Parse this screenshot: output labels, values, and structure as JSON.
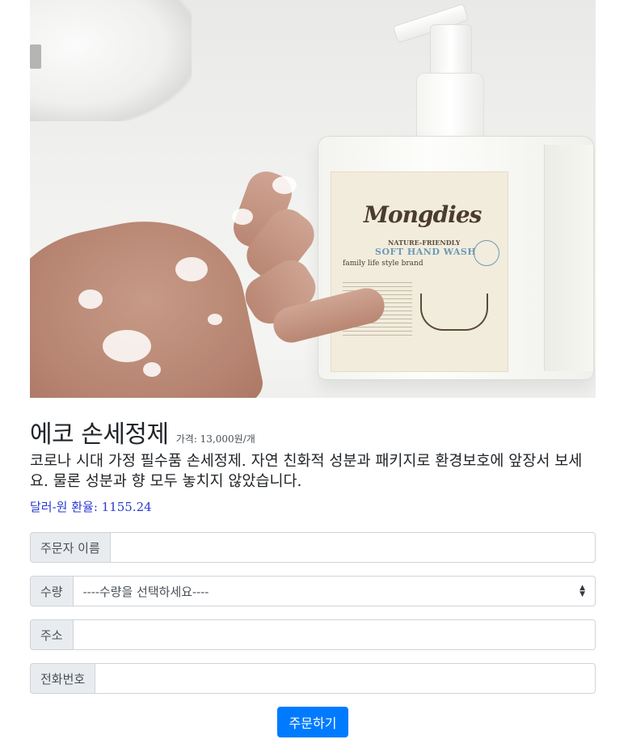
{
  "hero": {
    "image_alt": "Mongdies hand wash bottle with foamy hand",
    "brand_text": "Mongdies",
    "brand_sub": "NATURE-FRIENDLY",
    "product_line": "SOFT HAND WASH",
    "tagline": "family life style brand"
  },
  "product": {
    "title": "에코 손세정제",
    "price": "가격: 13,000원/개",
    "description": "코로나 시대 가정 필수품 손세정제. 자연 친화적 성분과 패키지로 환경보호에 앞장서 보세요. 물론 성분과 향 모두 놓치지 않았습니다.",
    "exchange_rate": "달러-원 환율: 1155.24"
  },
  "form": {
    "name_label": "주문자 이름",
    "name_value": "",
    "quantity_label": "수량",
    "quantity_selected": "----수량을 선택하세요----",
    "address_label": "주소",
    "address_value": "",
    "phone_label": "전화번호",
    "phone_value": "",
    "submit_label": "주문하기"
  },
  "colors": {
    "accent": "#007bff",
    "rate_text": "#2b3ad1",
    "addon_bg": "#e9ecef",
    "border": "#ced4da"
  }
}
